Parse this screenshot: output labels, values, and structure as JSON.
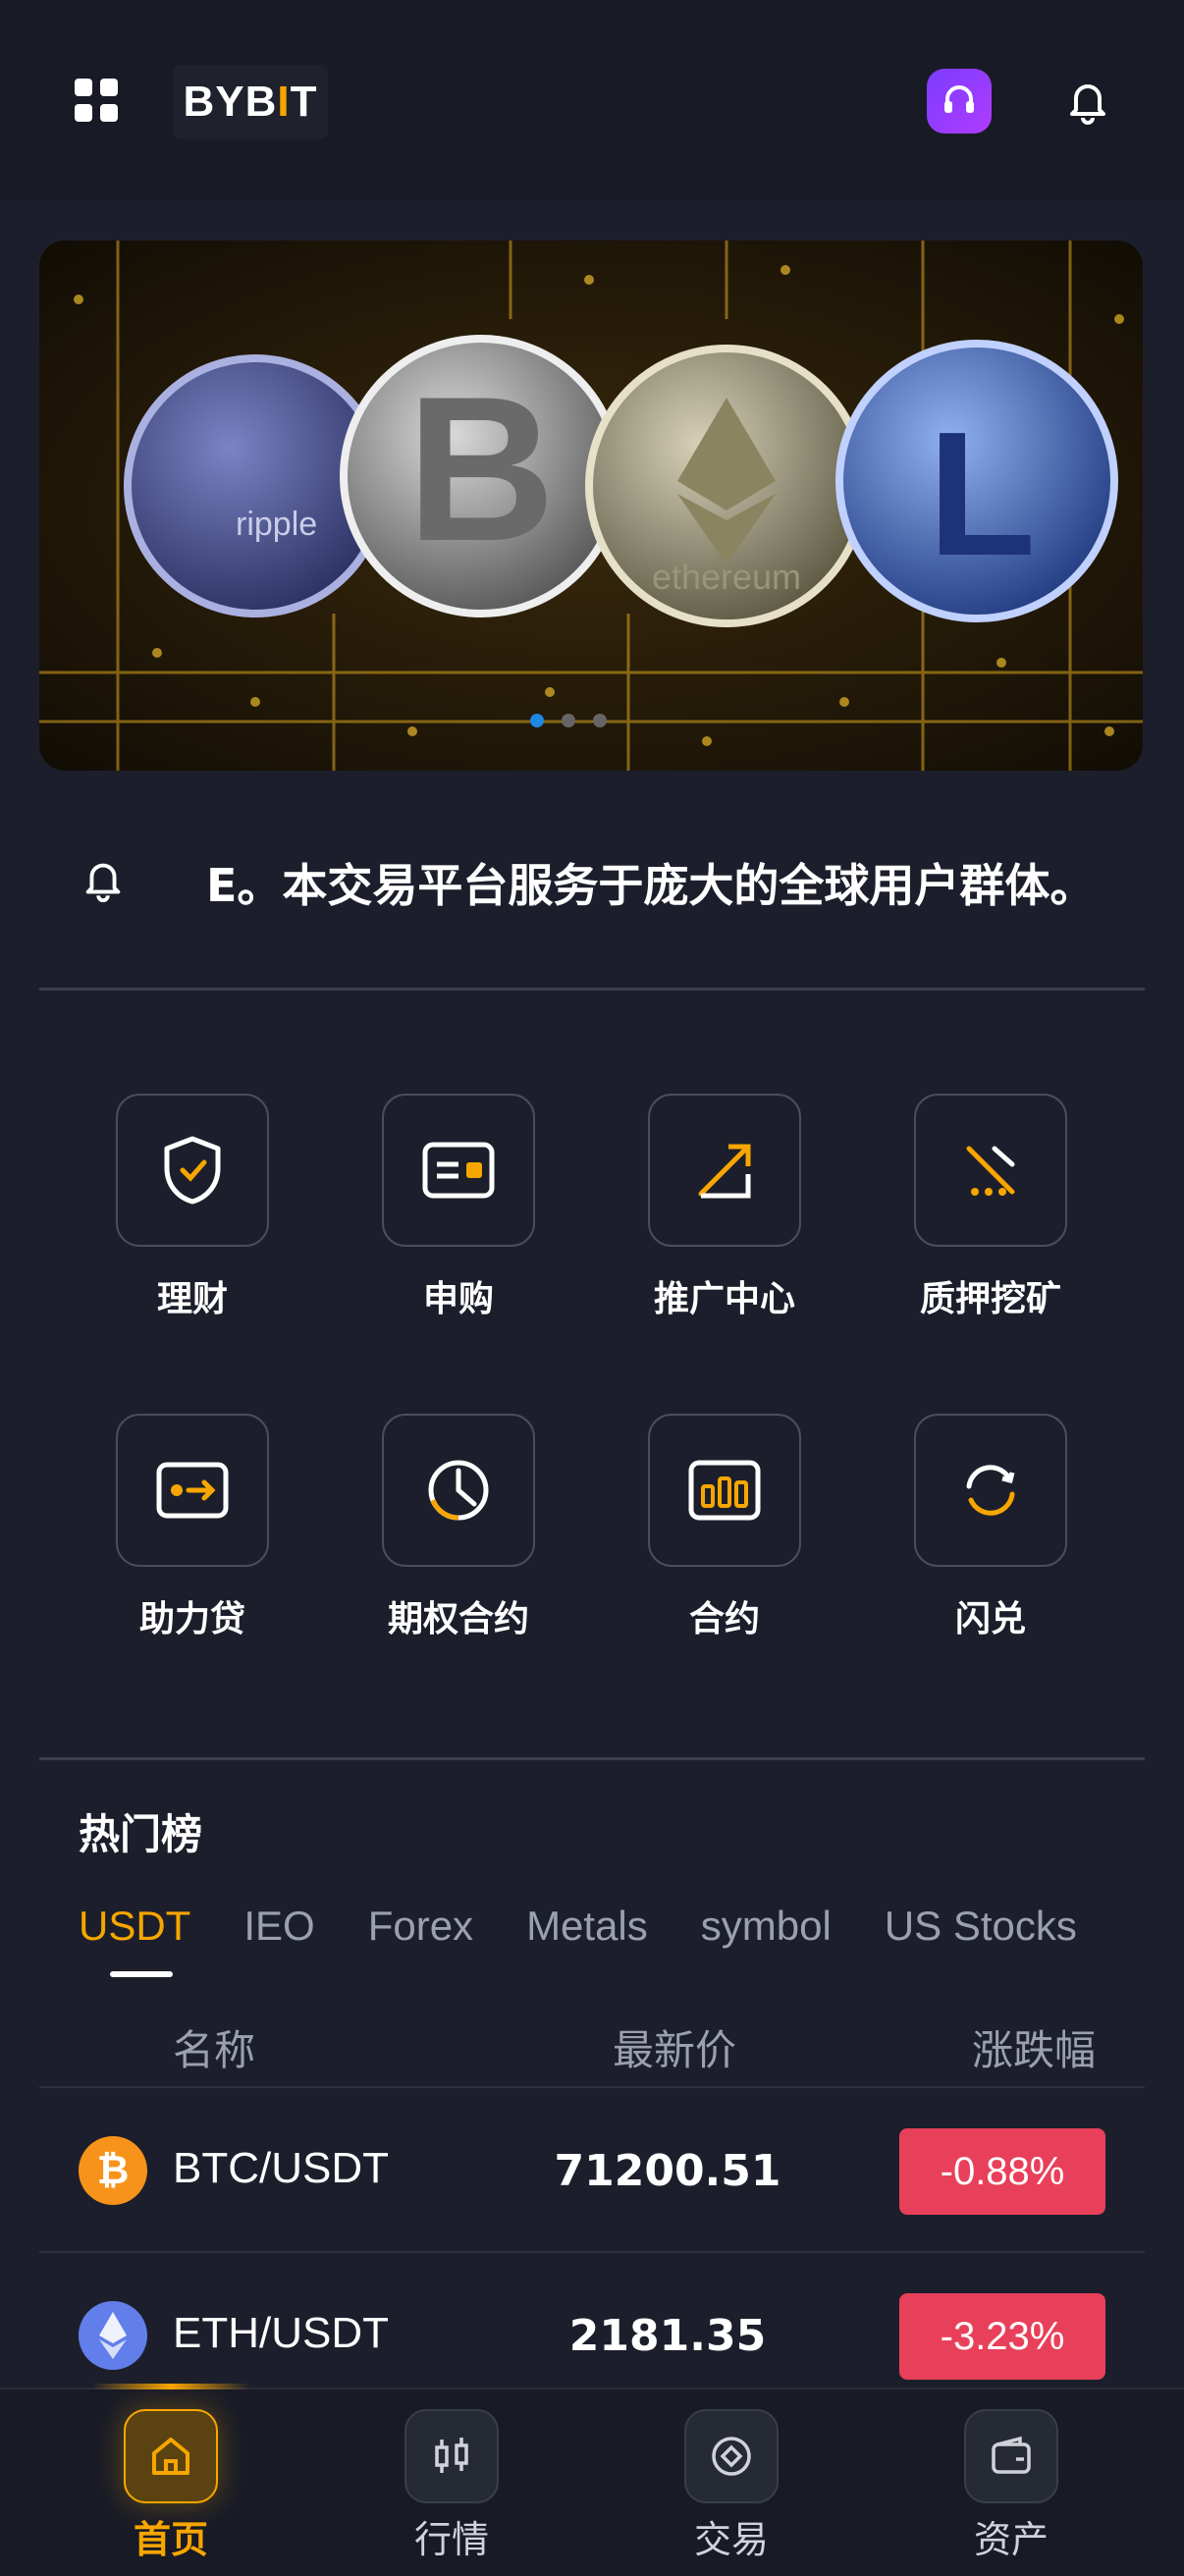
{
  "header": {
    "logo_text_1": "BYB",
    "logo_text_bar": "I",
    "logo_text_2": "T",
    "icons": [
      "grid-menu-icon",
      "headset-icon",
      "bell-icon"
    ]
  },
  "banner": {
    "image": "crypto-coins-on-circuit-board",
    "coin_labels": [
      "ripple",
      "ethereum"
    ],
    "slides": 3,
    "active_slide": 1
  },
  "notice": {
    "text": "E。本交易平台服务于庞大的全球用户群体。"
  },
  "features": [
    {
      "label": "理财",
      "icon": "shield-check-icon"
    },
    {
      "label": "申购",
      "icon": "card-icon"
    },
    {
      "label": "推广中心",
      "icon": "arrow-up-right-icon"
    },
    {
      "label": "质押挖矿",
      "icon": "pickaxe-icon"
    },
    {
      "label": "助力贷",
      "icon": "loan-card-icon"
    },
    {
      "label": "期权合约",
      "icon": "clock-chart-icon"
    },
    {
      "label": "合约",
      "icon": "bars-icon"
    },
    {
      "label": "闪兑",
      "icon": "exchange-icon"
    }
  ],
  "hot": {
    "title": "热门榜",
    "tabs": [
      "USDT",
      "IEO",
      "Forex",
      "Metals",
      "symbol",
      "US Stocks"
    ],
    "active_tab": "USDT",
    "columns": {
      "name": "名称",
      "price": "最新价",
      "change": "涨跌幅"
    },
    "rows": [
      {
        "pair": "BTC/USDT",
        "price": "71200.51",
        "change": "-0.88%",
        "coin": "btc-icon",
        "color": "#f7931a"
      },
      {
        "pair": "ETH/USDT",
        "price": "2181.35",
        "change": "-3.23%",
        "coin": "eth-icon",
        "color": "#627eea"
      }
    ]
  },
  "nav": {
    "items": [
      {
        "label": "首页",
        "icon": "home-icon"
      },
      {
        "label": "行情",
        "icon": "candlestick-icon"
      },
      {
        "label": "交易",
        "icon": "trade-icon"
      },
      {
        "label": "资产",
        "icon": "wallet-icon"
      }
    ],
    "active": "首页"
  },
  "colors": {
    "accent": "#f7a600",
    "down": "#e8405a",
    "bg": "#1c1f2b"
  }
}
